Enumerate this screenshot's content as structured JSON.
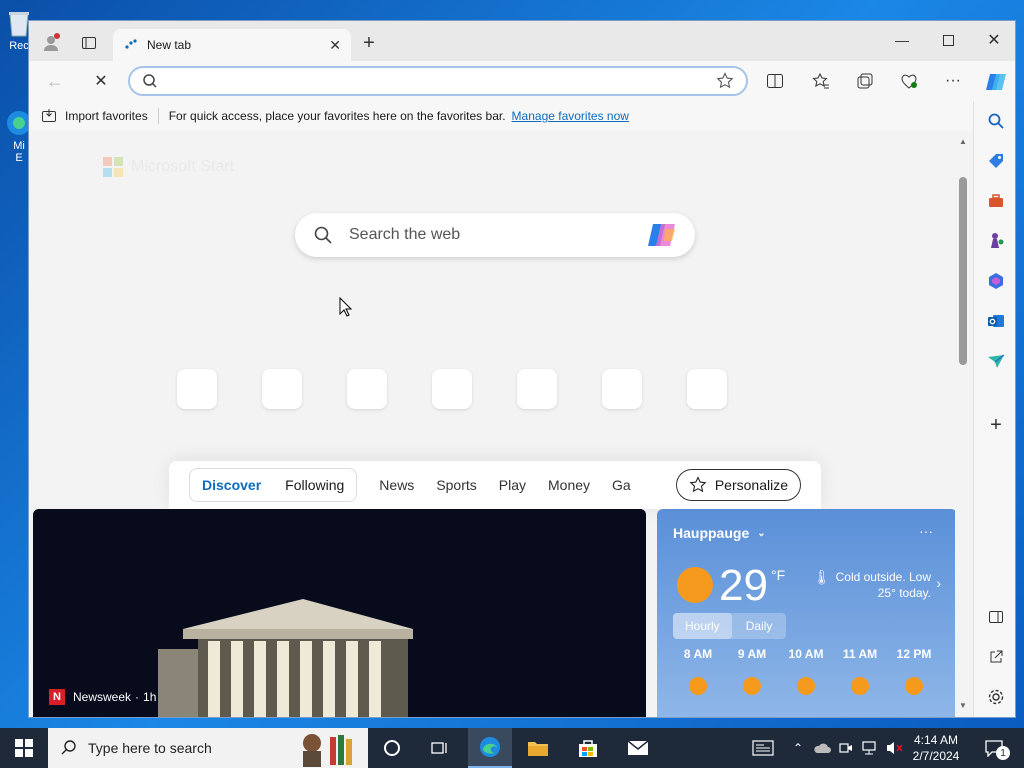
{
  "desktop": {
    "icons": [
      {
        "label": "Rec",
        "icon": "recycle-bin-icon"
      },
      {
        "label": "Mi\nE",
        "icon": "edge-desktop-icon"
      }
    ]
  },
  "browser": {
    "tab": {
      "title": "New tab"
    },
    "address": {
      "value": "",
      "placeholder": ""
    },
    "favorites_bar": {
      "import_label": "Import favorites",
      "hint": "For quick access, place your favorites here on the favorites bar.",
      "manage_link": "Manage favorites now"
    }
  },
  "newtab": {
    "brand": "Microsoft Start",
    "search_placeholder": "Search the web",
    "feed_tabs": {
      "discover": "Discover",
      "following": "Following",
      "items": [
        "News",
        "Sports",
        "Play",
        "Money",
        "Ga"
      ],
      "personalize": "Personalize"
    },
    "news_card": {
      "source": "Newsweek",
      "time": "1h"
    },
    "weather": {
      "location": "Hauppauge",
      "temp": "29",
      "unit": "°F",
      "desc": "Cold outside. Low 25° today.",
      "tabs": [
        "Hourly",
        "Daily"
      ],
      "hours": [
        "8 AM",
        "9 AM",
        "10 AM",
        "11 AM",
        "12 PM"
      ]
    }
  },
  "taskbar": {
    "search_placeholder": "Type here to search",
    "time": "4:14 AM",
    "date": "2/7/2024",
    "notification_count": "1"
  },
  "colors": {
    "accent": "#0f6cbd",
    "sun": "#f59a1d",
    "taskbar": "#1e2a3a"
  }
}
